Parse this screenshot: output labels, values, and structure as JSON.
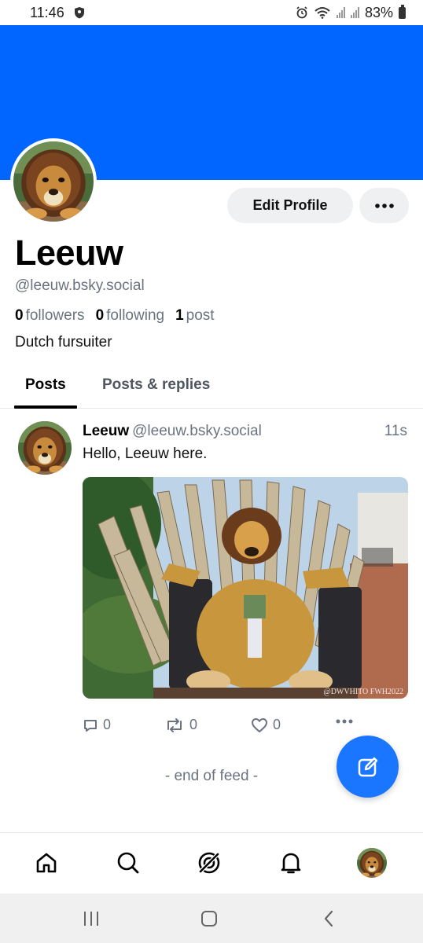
{
  "status_bar": {
    "time": "11:46",
    "battery": "83%",
    "icons": [
      "shield-icon",
      "alarm-icon",
      "wifi-icon",
      "signal-icon",
      "signal-icon",
      "battery-icon"
    ]
  },
  "colors": {
    "banner": "#0066ff",
    "accent": "#1a75ff",
    "muted": "#6b7380"
  },
  "profile": {
    "display_name": "Leeuw",
    "handle": "@leeuw.bsky.social",
    "edit_label": "Edit Profile",
    "more_icon": "ellipsis-icon",
    "followers_count": "0",
    "followers_label": "followers",
    "following_count": "0",
    "following_label": "following",
    "posts_count": "1",
    "posts_label": "post",
    "bio": "Dutch fursuiter"
  },
  "tabs": [
    {
      "label": "Posts",
      "active": true
    },
    {
      "label": "Posts & replies",
      "active": false
    }
  ],
  "post": {
    "author": "Leeuw",
    "handle": "@leeuw.bsky.social",
    "time": "11s",
    "text": "Hello, Leeuw here.",
    "image_watermark": "@DWVHITO FWH2022",
    "reply_count": "0",
    "repost_count": "0",
    "like_count": "0"
  },
  "feed_end": "- end of feed -",
  "bottom_nav": [
    "home-icon",
    "search-icon",
    "feeds-icon",
    "notifications-icon",
    "profile-avatar"
  ],
  "system_nav": [
    "recents-icon",
    "home-button-icon",
    "back-icon"
  ]
}
